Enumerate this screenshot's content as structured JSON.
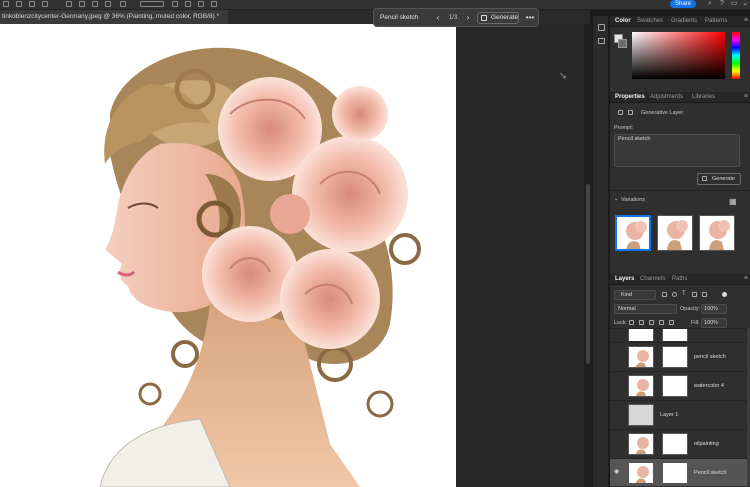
{
  "topbar": {
    "share_label": "Share"
  },
  "document": {
    "tab_title": "tinkoblenzcitycenter-Germany.jpeg @ 36% (Painting, muted color, RGB/8) *",
    "close_glyph": "×"
  },
  "taskbar": {
    "prompt_value": "Pencil sketch",
    "prev_glyph": "‹",
    "count": "1/3",
    "next_glyph": "›",
    "generate_label": "Generate",
    "more_glyph": "•••"
  },
  "color_panel": {
    "tabs": [
      "Color",
      "Swatches",
      "Gradients",
      "Patterns"
    ],
    "hue": "#ff0000"
  },
  "properties_panel": {
    "tabs": [
      "Properties",
      "Adjustments",
      "Libraries"
    ],
    "layer_type": "Generative Layer",
    "prompt_label": "Prompt:",
    "prompt_value": "Pencil sketch",
    "generate_label": "Generate",
    "variations_label": "Variations"
  },
  "layers_panel": {
    "tabs": [
      "Layers",
      "Channels",
      "Paths"
    ],
    "filter_value": "Kind",
    "blend_mode": "Normal",
    "opacity_label": "Opacity:",
    "opacity_value": "100%",
    "lock_label": "Lock:",
    "fill_label": "Fill:",
    "fill_value": "100%",
    "layers": [
      {
        "name": ""
      },
      {
        "name": "pencil sketch"
      },
      {
        "name": "watercolor 4"
      },
      {
        "name": "Layer 1"
      },
      {
        "name": "oilpainting"
      },
      {
        "name": "Pencil sketch",
        "selected": true
      }
    ]
  },
  "icons": [
    "move-icon",
    "align-icon",
    "search-icon",
    "help-icon",
    "workspace-icon",
    "eye-icon",
    "grid-icon",
    "generate-icon",
    "hand-cursor-icon"
  ]
}
